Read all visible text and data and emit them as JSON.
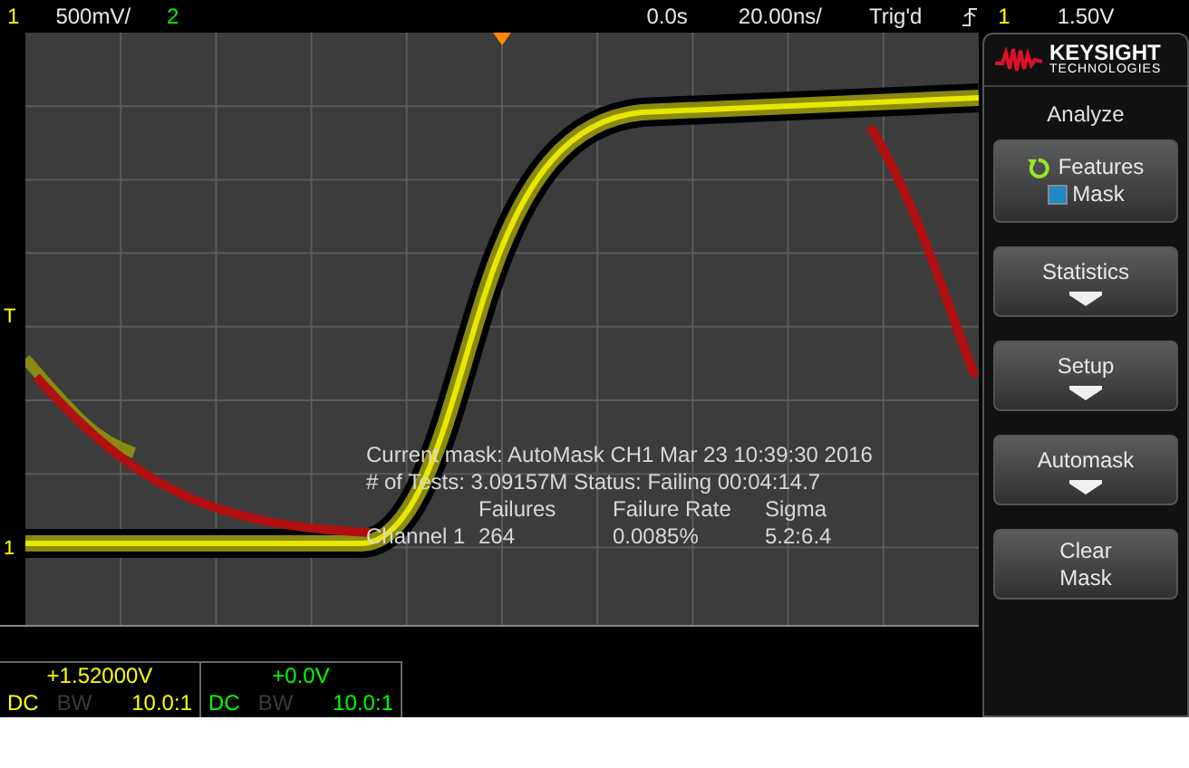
{
  "top_bar": {
    "ch1_label": "1",
    "ch1_scale": "500mV/",
    "ch2_label": "2",
    "time_offset": "0.0s",
    "time_scale": "20.00ns/",
    "trigger_status": "Trig'd",
    "trigger_source": "1",
    "trigger_level": "1.50V"
  },
  "graticule": {
    "trigger_marker": "T",
    "ch1_marker": "1"
  },
  "mask_test": {
    "current_mask": "Current mask: AutoMask CH1 Mar 23 10:39:30 2016",
    "tests": "# of Tests: 3.09157M  Status: Failing  00:04:14.7",
    "columns": [
      "Failures",
      "Failure Rate",
      "Sigma"
    ],
    "rows": [
      {
        "label": "Channel 1",
        "cells": [
          "264",
          "0.0085%",
          "5.2:6.4"
        ]
      }
    ]
  },
  "channels": [
    {
      "offset": "+1.52000V",
      "coupling": "DC",
      "bw_limit": "BW",
      "bw_on": false,
      "probe": "10.0:1",
      "color": "#ffff00"
    },
    {
      "offset": "+0.0V",
      "coupling": "DC",
      "bw_limit": "BW",
      "bw_on": false,
      "probe": "10.0:1",
      "color": "#00ff00"
    }
  ],
  "softkey_menu": {
    "brand": "KEYSIGHT",
    "brand_sub": "TECHNOLOGIES",
    "title": "Analyze",
    "keys": [
      {
        "kind": "cycle",
        "label": "Features",
        "option": "Mask",
        "checked": true
      },
      {
        "kind": "submenu",
        "label": "Statistics"
      },
      {
        "kind": "submenu",
        "label": "Setup"
      },
      {
        "kind": "submenu",
        "label": "Automask"
      },
      {
        "kind": "action",
        "label": "Clear\nMask"
      }
    ]
  }
}
